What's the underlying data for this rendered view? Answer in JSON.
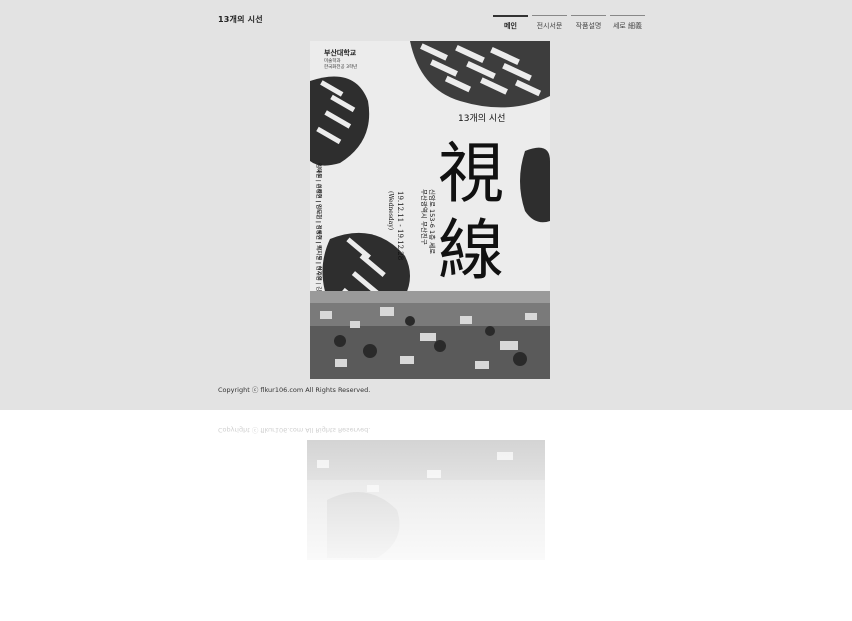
{
  "site": {
    "brand": "13개의 시선"
  },
  "nav": {
    "items": [
      {
        "label": "메인",
        "active": true
      },
      {
        "label": "전시서문",
        "active": false
      },
      {
        "label": "작품설명",
        "active": false
      },
      {
        "label": "세로 細義",
        "active": false
      }
    ]
  },
  "poster": {
    "school": "부산대학교",
    "dept": "미술학과",
    "major": "한국화전공 3학년",
    "subtitle": "13개의 시선",
    "title_1": "視",
    "title_2": "線",
    "dates": "19.12.11 - 19.12.28",
    "weekday": "(Wednesday)",
    "venue_1": "부산광역시 부산진구",
    "venue_2": "신암로 153-6 1층 세로",
    "artists_1": "김다운 | 손강현 | 김다현 | 김동현 | 박지윤 | 안지은",
    "artists_2": "이혜원 | 이해원 | 임도희 | 정혜원 | 최지원 | 허수영 | 김"
  },
  "footer": {
    "copyright": "Copyright ⓒ flkur106.com All Rights Reserved."
  },
  "colors": {
    "header_bg": "#e3e3e3",
    "page_bg": "#ffffff",
    "text": "#222222"
  }
}
